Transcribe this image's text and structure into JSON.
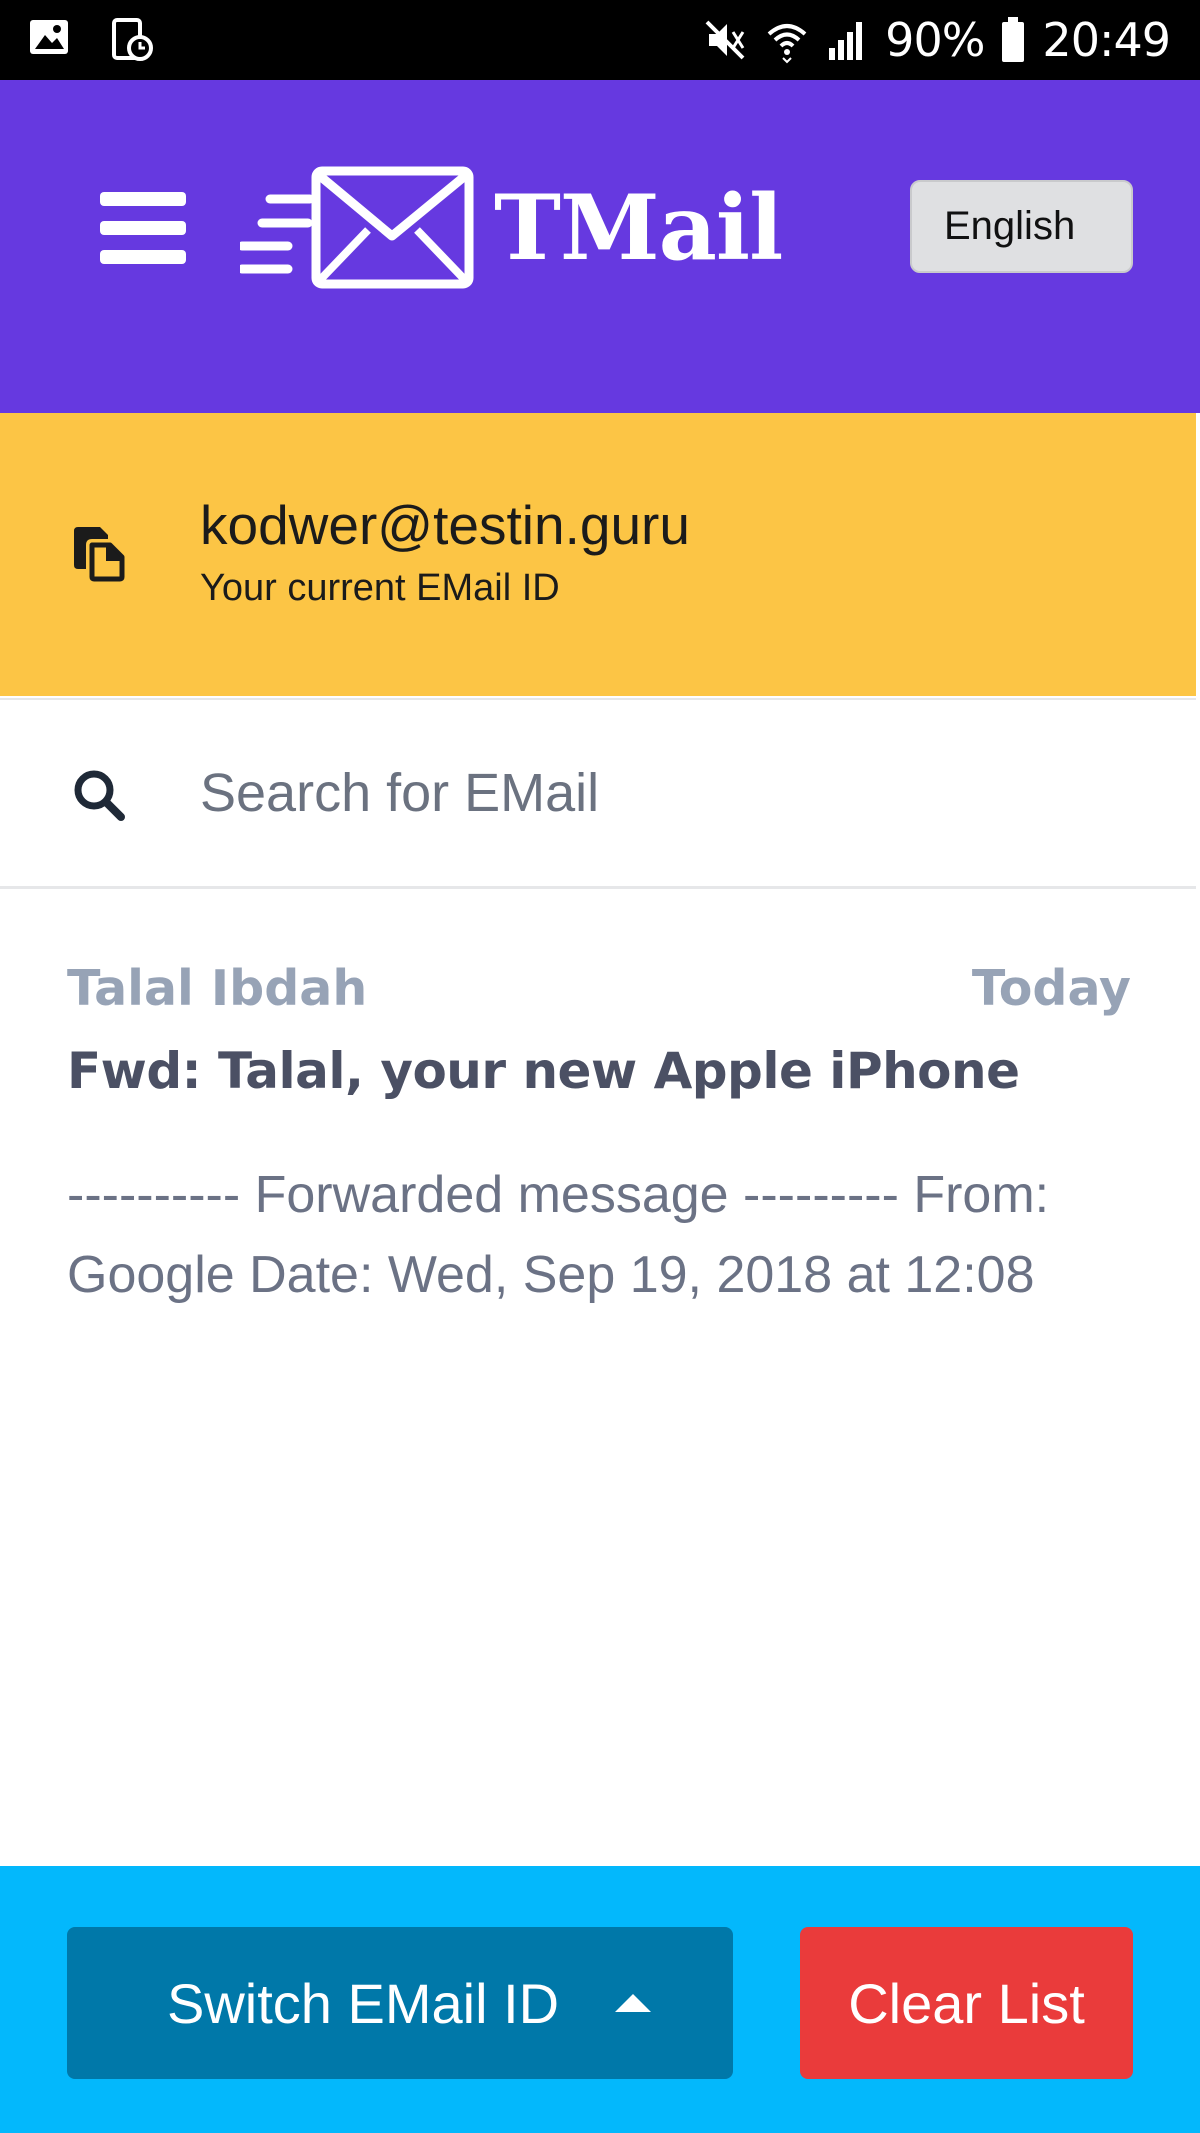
{
  "status_bar": {
    "battery": "90%",
    "time": "20:49",
    "icons": [
      "image-icon",
      "screenshot-icon",
      "mute-icon",
      "wifi-icon",
      "signal-icon",
      "battery-icon"
    ]
  },
  "header": {
    "menu_icon": "hamburger-icon",
    "logo_text": "TMail",
    "language_label": "English"
  },
  "current_email": {
    "address": "kodwer@testin.guru",
    "caption": "Your current EMail ID",
    "icon": "copy-icon"
  },
  "search": {
    "placeholder": "Search for EMail",
    "icon": "search-icon"
  },
  "messages": [
    {
      "from": "Talal Ibdah",
      "date": "Today",
      "subject": "Fwd: Talal, your new Apple iPhone",
      "preview": "---------- Forwarded message --------- From: Google Date: Wed, Sep 19, 2018 at 12:08"
    }
  ],
  "bottom_bar": {
    "switch_label": "Switch EMail ID",
    "clear_label": "Clear List"
  },
  "colors": {
    "header": "#6639e0",
    "current_email_bg": "#fcc545",
    "bottom_bar": "#03b8fc",
    "switch_button": "#0078a9",
    "clear_button": "#ea3b3b"
  }
}
